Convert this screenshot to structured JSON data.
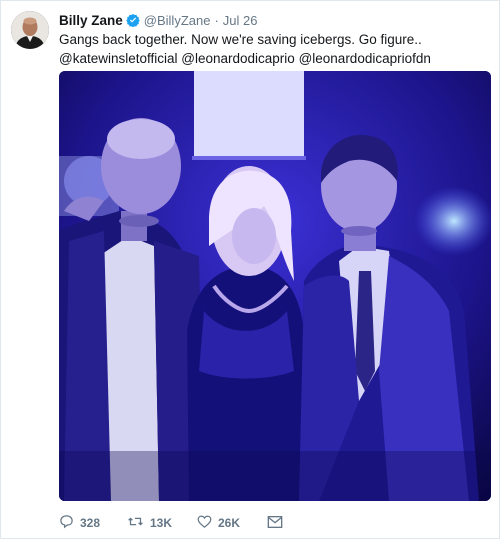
{
  "tweet": {
    "author_name": "Billy Zane",
    "handle": "@BillyZane",
    "separator": "·",
    "date": "Jul 26",
    "text_line1": "Gangs back together. Now we're saving icebergs. Go figure..",
    "mentions": [
      "@katewinsletofficial",
      "@leonardodicaprio",
      "@leonardodicapriofdn"
    ]
  },
  "media": {
    "icon": "photo"
  },
  "actions": {
    "reply_count": "328",
    "retweet_count": "13K",
    "like_count": "26K"
  },
  "colors": {
    "verified": "#1da1f2",
    "secondary_text": "#657786",
    "photo_tint": "#2a1fd0"
  }
}
